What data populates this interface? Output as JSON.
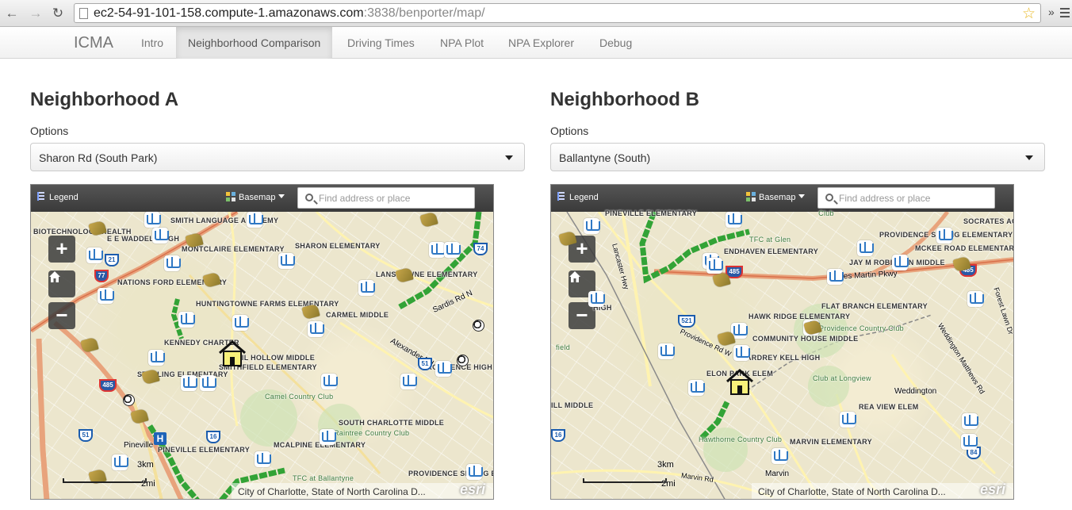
{
  "browser": {
    "url_host": "ec2-54-91-101-158.compute-1.amazonaws.com",
    "url_path": ":3838/benporter/map/",
    "back_glyph": "←",
    "forward_glyph": "→",
    "reload_glyph": "↻",
    "bookmark_glyph": "☆",
    "overflow_glyph": "»"
  },
  "navbar": {
    "brand": "ICMA",
    "tabs": [
      {
        "label": "Intro"
      },
      {
        "label": "Neighborhood Comparison",
        "active": true
      },
      {
        "label": "Driving Times"
      },
      {
        "label": "NPA Plot"
      },
      {
        "label": "NPA Explorer"
      },
      {
        "label": "Debug"
      }
    ]
  },
  "map_common": {
    "legend_label": "Legend",
    "basemap_label": "Basemap",
    "search_placeholder": "Find address or place",
    "zoom_in": "+",
    "zoom_out": "−",
    "scale_km": "3km",
    "scale_mi": "2mi",
    "attribution": "City of Charlotte, State of North Carolina D...",
    "esri": "esri",
    "icons": [
      "school-icon",
      "library-icon",
      "park-icon",
      "house-icon",
      "home-icon",
      "search-icon",
      "hospital-icon"
    ]
  },
  "panel_a": {
    "title": "Neighborhood A",
    "options_label": "Options",
    "selected": "Sharon Rd (South Park)",
    "labels": [
      "SMITH LANGUAGE ACADEMY",
      "BIOTECHNOLOGY HEALTH",
      "E E WADDELL HIGH",
      "MONTCLAIRE ELEMENTARY",
      "SHARON ELEMENTARY",
      "LANSDOWNE ELEMENTARY",
      "NATIONS FORD ELEMENTARY",
      "HUNTINGTOWNE FARMS ELEMENTARY",
      "CARMEL MIDDLE",
      "KENNEDY CHARTER",
      "QUAIL HOLLOW MIDDLE",
      "SMITHFIELD ELEMENTARY",
      "STERLING ELEMENTARY",
      "PROVIDENCE HIGH",
      "SOUTH CHARLOTTE MIDDLE",
      "MCALPINE ELEMENTARY",
      "PINEVILLE ELEMENTARY",
      "PROVIDENCE SPRING E",
      "Pineville",
      "Sardis Rd N",
      "Alexander Rd"
    ],
    "parks": [
      "Camel Country Club",
      "Raintree Country Club",
      "TFC at Ballantyne"
    ],
    "shields": [
      "21",
      "77",
      "485",
      "51",
      "16",
      "51",
      "74"
    ]
  },
  "panel_b": {
    "title": "Neighborhood B",
    "options_label": "Options",
    "selected": "Ballantyne (South)",
    "labels": [
      "PINEVILLE ELEMENTARY",
      "SOCRATES ACA",
      "PROVIDENCE SPRING ELEMENTARY",
      "ENDHAVEN ELEMENTARY",
      "MCKEE ROAD ELEMENTARY",
      "JAY M ROBINSON MIDDLE",
      "HIGH",
      "FLAT BRANCH ELEMENTARY",
      "HAWK RIDGE ELEMENTARY",
      "COMMUNITY HOUSE MIDDLE",
      "ARDREY KELL HIGH",
      "ELON PARK ELEM",
      "ILL MIDDLE",
      "REA VIEW ELEM",
      "MARVIN ELEMENTARY",
      "Weddington",
      "Marvin",
      "James Martin Pkwy",
      "Lancaster Hwy",
      "Providence Rd W",
      "Marvin Rd",
      "Weddington Matthews Rd",
      "Forest Lawn Dr"
    ],
    "parks": [
      "TFC at Glen",
      "Providence Country Club",
      "Club at Longview",
      "Hawthorne Country Club",
      "Club",
      "field"
    ],
    "shields": [
      "485",
      "521",
      "16",
      "84",
      "485"
    ]
  }
}
